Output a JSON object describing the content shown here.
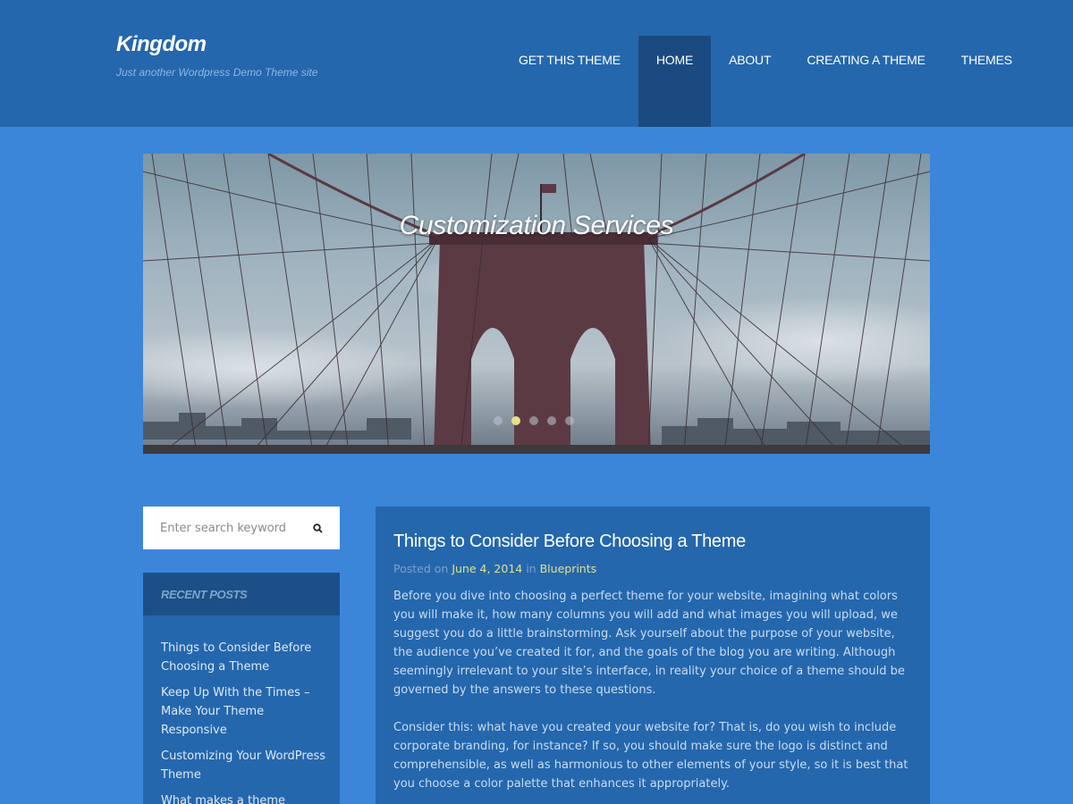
{
  "header": {
    "site_title": "Kingdom",
    "tagline": "Just another Wordpress Demo Theme site",
    "nav": [
      {
        "label": "GET THIS THEME"
      },
      {
        "label": "HOME",
        "active": true
      },
      {
        "label": "ABOUT"
      },
      {
        "label": "CREATING A THEME"
      },
      {
        "label": "THEMES"
      }
    ]
  },
  "slider": {
    "caption": "Customization Services",
    "slide_count": 5,
    "active_slide": 2
  },
  "sidebar": {
    "search": {
      "placeholder": "Enter search keyword",
      "icon": "search-icon"
    },
    "recent_posts": {
      "title": "RECENT POSTS",
      "items": [
        {
          "label": "Things to Consider Before Choosing a Theme"
        },
        {
          "label": "Keep Up With the Times – Make Your Theme Responsive"
        },
        {
          "label": "Customizing Your WordPress Theme"
        },
        {
          "label": "What makes a theme perfect?"
        }
      ]
    }
  },
  "post": {
    "title": "Things to Consider Before Choosing a Theme",
    "meta": {
      "posted_on_label": "Posted on",
      "date": "June 4, 2014",
      "in_label": "in",
      "category": "Blueprints"
    },
    "paragraphs": [
      "Before you dive into choosing a perfect theme for your website, imagining what colors you will make it, how many columns you will add and what images you will upload, we suggest you do a little brainstorming. Ask yourself about the purpose of your website, the audience you’ve created it for, and the goals of the blog you are writing. Although seemingly irrelevant to your site’s interface, in reality your choice of a theme should be governed by the answers to these questions.",
      "Consider this: what have you created your website for? That is, do you wish to include corporate branding, for instance? If so, you should make sure the logo is distinct and comprehensible, as well as harmonious to other elements of your style, so it is best that you choose a color palette that enhances it appropriately."
    ]
  },
  "colors": {
    "page_bg": "#3b86d8",
    "header_bg": "#2467ad",
    "nav_active_bg": "#1b4a80",
    "accent_yellow": "#e6e08a"
  }
}
